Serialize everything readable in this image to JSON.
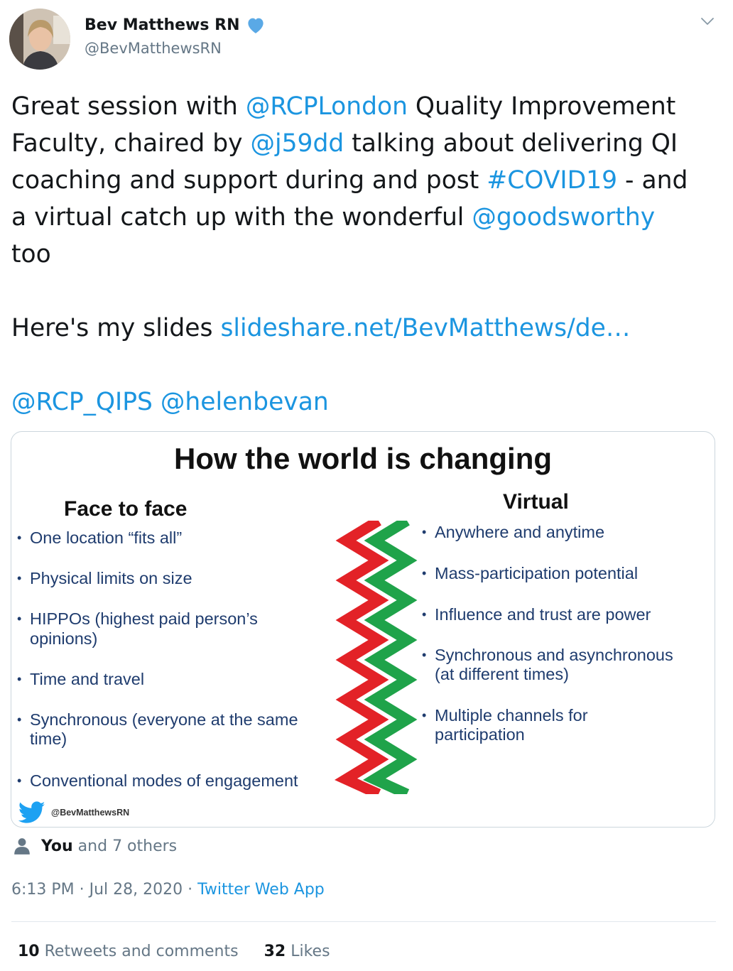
{
  "author": {
    "name": "Bev Matthews RN",
    "handle": "@BevMatthewsRN",
    "verified_color": "#1da1f2"
  },
  "tweet": {
    "line1": [
      "Great session with ",
      "@RCPLondon",
      " Quality Improvement"
    ],
    "line2": [
      "Faculty, chaired by ",
      "@j59dd",
      " talking about delivering QI"
    ],
    "line3": [
      "coaching and support during and post ",
      "#COVID19",
      " - and"
    ],
    "line4": [
      "a virtual catch up with the wonderful ",
      "@goodsworthy"
    ],
    "line5": "too",
    "slides_prefix": "Here's my slides ",
    "slides_link": "slideshare.net/BevMatthews/de…",
    "mention_1": "@RCP_QIPS",
    "mention_2": "@helenbevan",
    "link_color": "#1b95e0"
  },
  "slide": {
    "title": "How the world is changing",
    "left_heading": "Face to face",
    "left_items": [
      "One location “fits all”",
      "Physical limits on size",
      "HIPPOs (highest paid person’s",
      "opinions)",
      "Time and travel",
      "Synchronous (everyone at the same",
      "time)",
      "Conventional modes of engagement"
    ],
    "right_heading": "Virtual",
    "right_items": [
      "Anywhere and anytime",
      "Mass-participation potential",
      "Influence and trust are power",
      "Synchronous and asynchronous",
      "(at different times)",
      "Multiple channels for",
      "participation"
    ],
    "watermark": "@BevMatthewsRN",
    "zigzag_colors": [
      "#e32227",
      "#1fa34a"
    ]
  },
  "likers": {
    "you": "You",
    "others": " and 7 others"
  },
  "meta": {
    "time_date": "6:13 PM · Jul 28, 2020 · ",
    "source": "Twitter Web App"
  },
  "stats": {
    "retweets_count": "10",
    "retweets_label": " Retweets and comments",
    "likes_count": "32",
    "likes_label": " Likes"
  }
}
